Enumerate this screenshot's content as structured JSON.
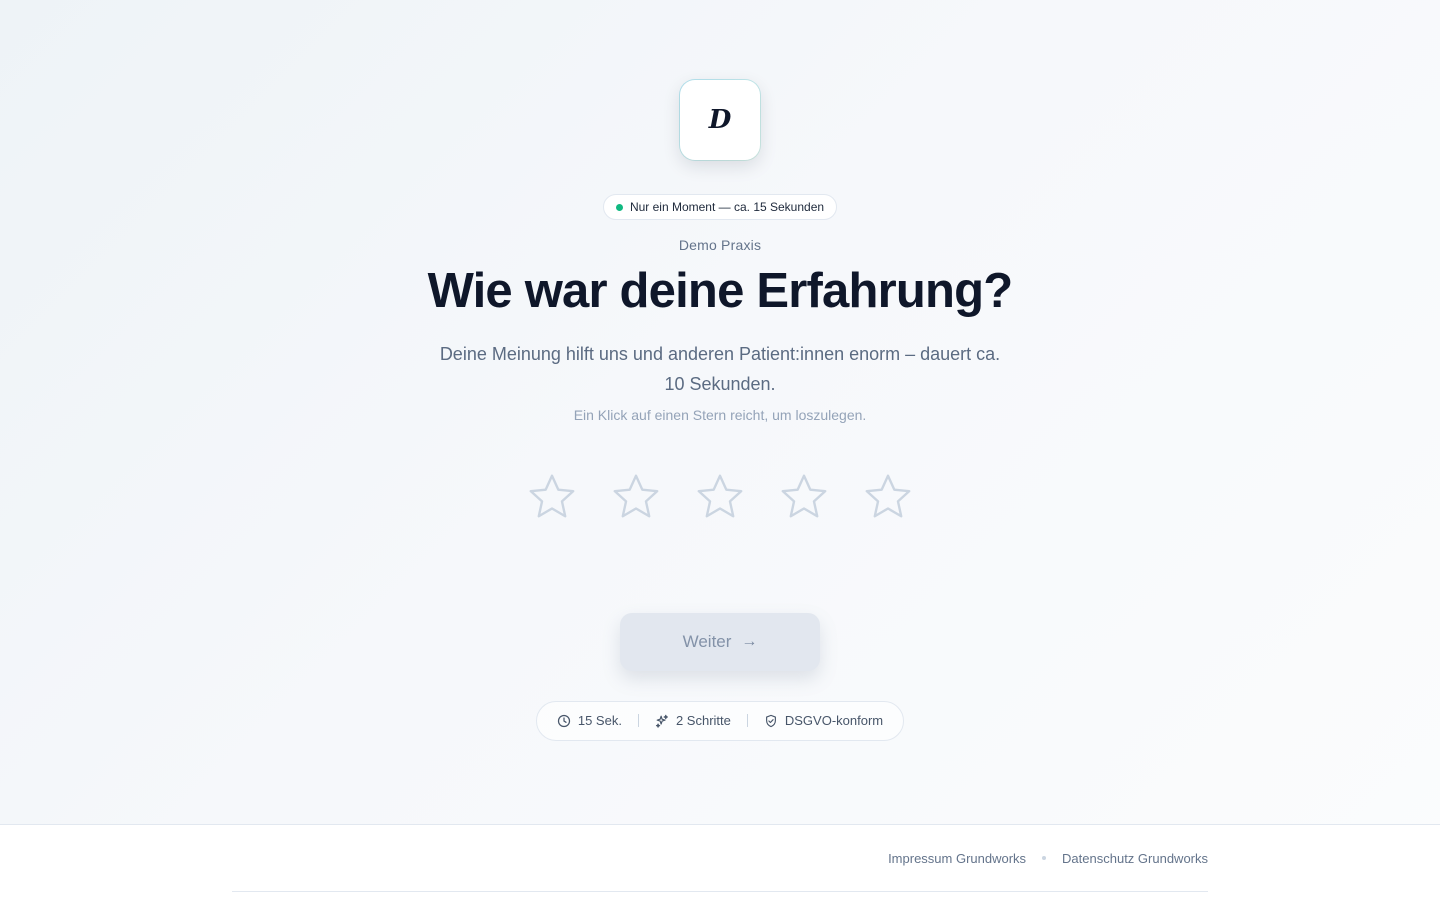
{
  "logo": {
    "letter": "D"
  },
  "pill": {
    "text": "Nur ein Moment — ca. 15 Sekunden"
  },
  "praxis_name": "Demo Praxis",
  "title": "Wie war deine Erfahrung?",
  "subtitle": "Deine Meinung hilft uns und anderen Patient:innen enorm – dauert ca. 10 Sekunden.",
  "hint": "Ein Klick auf einen Stern reicht, um loszulegen.",
  "rating": {
    "max": 5,
    "selected": 0,
    "star_color": "#cbd5e1"
  },
  "cta": {
    "label": "Weiter",
    "arrow": "→"
  },
  "badges": [
    {
      "icon": "clock-icon",
      "label": "15 Sek."
    },
    {
      "icon": "sparkles-icon",
      "label": "2 Schritte"
    },
    {
      "icon": "shield-check-icon",
      "label": "DSGVO-konform"
    }
  ],
  "footer": {
    "links": [
      "Impressum Grundworks",
      "Datenschutz Grundworks"
    ]
  },
  "colors": {
    "accent_dot": "#10b981",
    "title": "#0f172a",
    "muted": "#64748b"
  }
}
